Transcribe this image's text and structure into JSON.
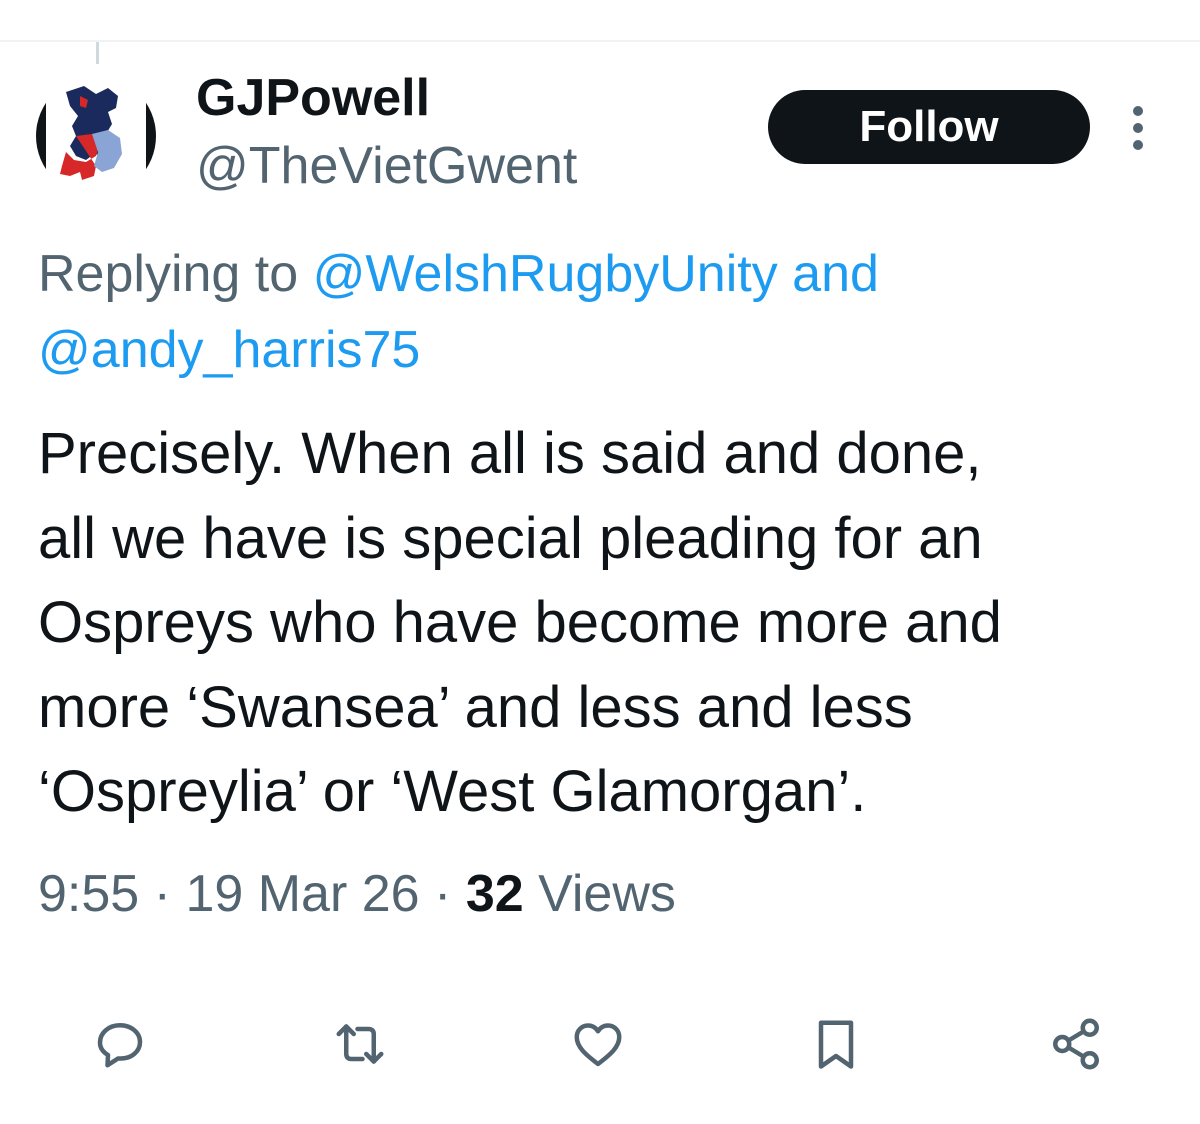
{
  "user": {
    "display_name": "GJPowell",
    "handle": "@TheVietGwent"
  },
  "follow_label": "Follow",
  "reply": {
    "prefix": "Replying to",
    "mention1": "@WelshRugbyUnity",
    "joiner": "and",
    "mention2": "@andy_harris75"
  },
  "tweet": {
    "text": "Precisely. When all is said and done,\nall we have is special pleading for an\nOspreys who have become more and\nmore ‘Swansea’ and less and less\n‘Ospreylia’ or ‘West Glamorgan’."
  },
  "meta": {
    "time": "9:55",
    "separator": "·",
    "date": "19 Mar 26",
    "views_count": "32",
    "views_label": "Views"
  },
  "actions": [
    "reply-icon",
    "retweet-icon",
    "like-icon",
    "bookmark-icon",
    "share-icon"
  ],
  "colors": {
    "text": "#0f1419",
    "secondary": "#536471",
    "link": "#1d9bf0",
    "button_bg": "#0f1419"
  }
}
